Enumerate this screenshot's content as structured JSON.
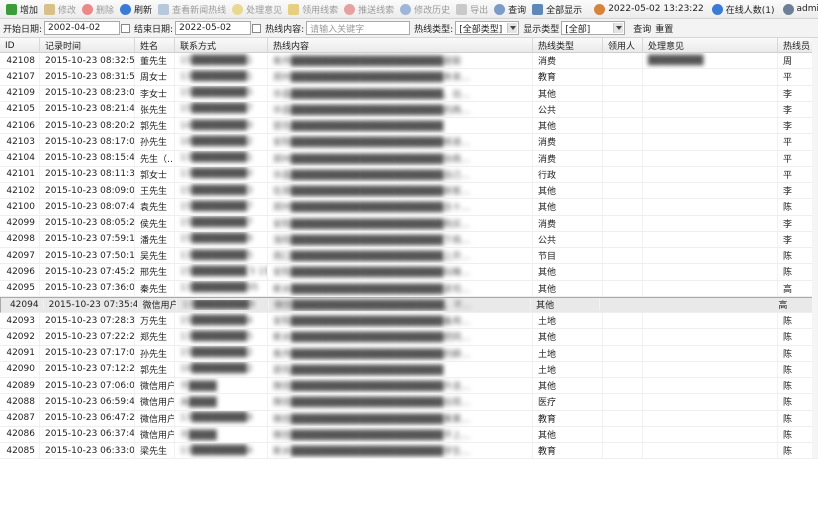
{
  "toolbar": {
    "add": "增加",
    "edit": "修改",
    "delete": "删除",
    "refresh": "刷新",
    "view_new": "查看新闻热线",
    "process": "处理意见",
    "claim": "领用线索",
    "push": "推送线索",
    "history": "修改历史",
    "export": "导出",
    "query": "查询",
    "show_all": "全部显示",
    "datetime": "2022-05-02 13:23:22",
    "online": "在线人数(1)",
    "user": "admin"
  },
  "filter": {
    "start_label": "开始日期:",
    "start_value": "2002-04-02",
    "end_label": "结束日期:",
    "end_value": "2022-05-02",
    "content_label": "热线内容:",
    "content_placeholder": "请输入关键字",
    "type_label": "热线类型:",
    "type_value": "[全部类型]",
    "display_label": "显示类型",
    "display_value": "[全部]",
    "query_btn": "查询",
    "reset_btn": "重置"
  },
  "columns": [
    "ID",
    "记录时间",
    "姓名",
    "联系方式",
    "热线内容",
    "热线类型",
    "领用人",
    "处理意见",
    "热线员"
  ],
  "rows": [
    {
      "id": "42108",
      "time": "2015-10-23 08:32:55",
      "name": "董先生",
      "phone": "15████████1",
      "content": "焦作██████████████████████是联",
      "type": "消费",
      "receiver": "",
      "opinion": "████████",
      "operator": "周"
    },
    {
      "id": "42107",
      "time": "2015-10-23 08:31:54",
      "name": "周女士",
      "phone": "13████████1",
      "content": "郑州██████████████████████本来…",
      "type": "教育",
      "receiver": "",
      "opinion": "",
      "operator": "平"
    },
    {
      "id": "42109",
      "time": "2015-10-23 08:23:04",
      "name": "李女士",
      "phone": "15████████5",
      "content": "许昌██████████████████████，出…",
      "type": "其他",
      "receiver": "",
      "opinion": "",
      "operator": "李"
    },
    {
      "id": "42105",
      "time": "2015-10-23 08:21:47",
      "name": "张先生",
      "phone": "15████████7",
      "content": "许昌██████████████████████的两…",
      "type": "公共",
      "receiver": "",
      "opinion": "",
      "operator": "李"
    },
    {
      "id": "42106",
      "time": "2015-10-23 08:20:28",
      "name": "郭先生",
      "phone": "14████████9",
      "content": "郭先██████████████████████",
      "type": "其他",
      "receiver": "",
      "opinion": "",
      "operator": "李"
    },
    {
      "id": "42103",
      "time": "2015-10-23 08:17:03",
      "name": "孙先生",
      "phone": "18████████2",
      "content": "安阳██████████████████████咳道…",
      "type": "消费",
      "receiver": "",
      "opinion": "",
      "operator": "平"
    },
    {
      "id": "42104",
      "time": "2015-10-23 08:15:48",
      "name": "先生（…",
      "phone": "13████████1",
      "content": "郑州██████████████████████协商…",
      "type": "消费",
      "receiver": "",
      "opinion": "",
      "operator": "平"
    },
    {
      "id": "42101",
      "time": "2015-10-23 08:11:30",
      "name": "郭女士",
      "phone": "13████████0",
      "content": "许昌██████████████████████自己…",
      "type": "行政",
      "receiver": "",
      "opinion": "",
      "operator": "平"
    },
    {
      "id": "42102",
      "time": "2015-10-23 08:09:06",
      "name": "王先生",
      "phone": "15████████3",
      "content": "在郑██████████████████████郎客…",
      "type": "其他",
      "receiver": "",
      "opinion": "",
      "operator": "李"
    },
    {
      "id": "42100",
      "time": "2015-10-23 08:07:48",
      "name": "袁先生",
      "phone": "15████████7",
      "content": "郑州██████████████████████去十…",
      "type": "其他",
      "receiver": "",
      "opinion": "",
      "operator": "陈"
    },
    {
      "id": "42099",
      "time": "2015-10-23 08:05:29",
      "name": "侯先生",
      "phone": "15████████7",
      "content": "安阳██████████████████████购买…",
      "type": "消费",
      "receiver": "",
      "opinion": "",
      "operator": "李"
    },
    {
      "id": "42098",
      "time": "2015-10-23 07:59:16",
      "name": "潘先生",
      "phone": "15████████9",
      "content": "洛阳██████████████████████下雨…",
      "type": "公共",
      "receiver": "",
      "opinion": "",
      "operator": "李"
    },
    {
      "id": "42097",
      "time": "2015-10-23 07:50:14",
      "name": "吴先生",
      "phone": "13████████5",
      "content": "周口██████████████████████上开…",
      "type": "节目",
      "receiver": "",
      "opinion": "",
      "operator": "陈"
    },
    {
      "id": "42096",
      "time": "2015-10-23 07:45:20",
      "name": "邢先生",
      "phone": "15████████ 5 15████",
      "content": "安阳██████████████████████玩睡…",
      "type": "其他",
      "receiver": "",
      "opinion": "",
      "operator": "陈"
    },
    {
      "id": "42095",
      "time": "2015-10-23 07:36:06",
      "name": "秦先生",
      "phone": "13████████95",
      "content": "新乡██████████████████████求司…",
      "type": "其他",
      "receiver": "",
      "opinion": "",
      "operator": "高"
    },
    {
      "id": "42094",
      "time": "2015-10-23 07:35:40",
      "name": "微信用户",
      "phone": "13████████9",
      "content": "微信██████████████████████，不…",
      "type": "其他",
      "receiver": "",
      "opinion": "",
      "operator": "高"
    },
    {
      "id": "42093",
      "time": "2015-10-23 07:28:37",
      "name": "万先生",
      "phone": "15████████4",
      "content": "安阳██████████████████████备用…",
      "type": "土地",
      "receiver": "",
      "opinion": "",
      "operator": "陈"
    },
    {
      "id": "42092",
      "time": "2015-10-23 07:22:20",
      "name": "郑先生",
      "phone": "13████████5",
      "content": "新乡██████████████████████把同…",
      "type": "其他",
      "receiver": "",
      "opinion": "",
      "operator": "陈"
    },
    {
      "id": "42091",
      "time": "2015-10-23 07:17:09",
      "name": "孙先生",
      "phone": "15████████2",
      "content": "焦作██████████████████████的耕…",
      "type": "土地",
      "receiver": "",
      "opinion": "",
      "operator": "陈"
    },
    {
      "id": "42090",
      "time": "2015-10-23 07:12:23",
      "name": "郭先生",
      "phone": "18████████2",
      "content": "郭先██████████████████████",
      "type": "土地",
      "receiver": "",
      "opinion": "",
      "operator": "陈"
    },
    {
      "id": "42089",
      "time": "2015-10-23 07:06:07",
      "name": "微信用户",
      "phone": "不████",
      "content": "微信██████████████████████升龙…",
      "type": "其他",
      "receiver": "",
      "opinion": "",
      "operator": "陈"
    },
    {
      "id": "42088",
      "time": "2015-10-23 06:59:45",
      "name": "微信用户",
      "phone": "未████",
      "content": "微信██████████████████████出现…",
      "type": "医疗",
      "receiver": "",
      "opinion": "",
      "operator": "陈"
    },
    {
      "id": "42087",
      "time": "2015-10-23 06:47:20",
      "name": "微信用户",
      "phone": "13████████8",
      "content": "微信██████████████████████果果…",
      "type": "教育",
      "receiver": "",
      "opinion": "",
      "operator": "陈"
    },
    {
      "id": "42086",
      "time": "2015-10-23 06:37:49",
      "name": "微信用户",
      "phone": "不████",
      "content": "微信██████████████████████平上…",
      "type": "其他",
      "receiver": "",
      "opinion": "",
      "operator": "陈"
    },
    {
      "id": "42085",
      "time": "2015-10-23 06:33:08",
      "name": "梁先生",
      "phone": "13████████4",
      "content": "新乡██████████████████████学生…",
      "type": "教育",
      "receiver": "",
      "opinion": "",
      "operator": "陈"
    }
  ],
  "colors": {
    "add": "#3a9d3a",
    "edit": "#c9a24a",
    "delete": "#d44",
    "refresh": "#3a7bd5"
  }
}
